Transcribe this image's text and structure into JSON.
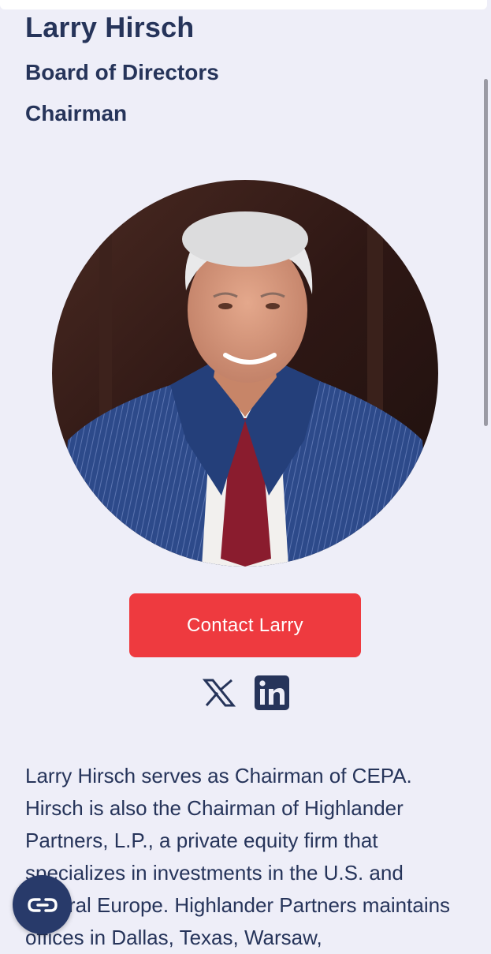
{
  "profile": {
    "name": "Larry Hirsch",
    "role_1": "Board of Directors",
    "role_2": "Chairman",
    "contact_label": "Contact Larry"
  },
  "social": {
    "icons": [
      "x-icon",
      "linkedin-icon"
    ]
  },
  "bio": {
    "text": "Larry Hirsch serves as Chairman of CEPA. Hirsch is also the Chairman of Highlander Partners, L.P., a private equity firm that specializes in investments in the U.S. and Central Europe. Highlander Partners maintains offices in Dallas, Texas, Warsaw,"
  },
  "chat": {
    "icon": "chat-link-icon"
  },
  "colors": {
    "accent": "#ee3a3f",
    "heading": "#26345a",
    "background": "#eeeef8",
    "fab": "#283a6a"
  }
}
